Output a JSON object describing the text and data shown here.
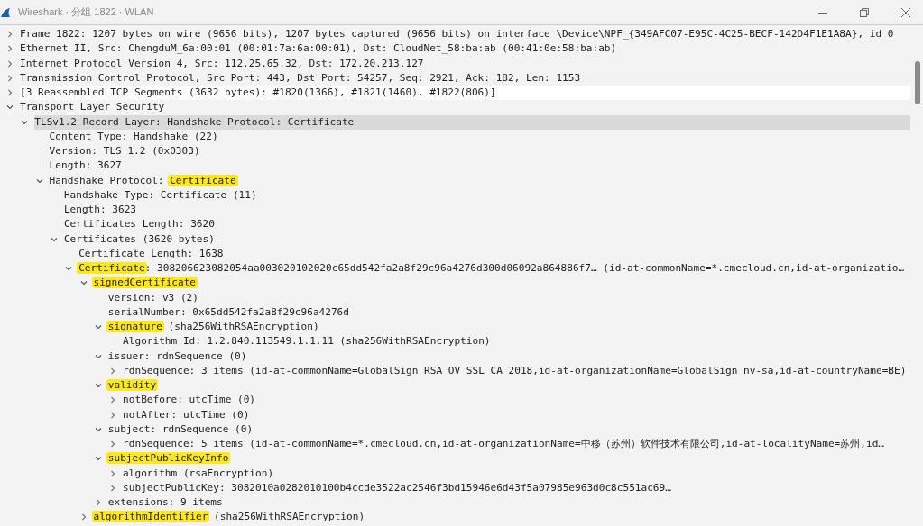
{
  "window": {
    "title": "Wireshark · 分组 1822 · WLAN"
  },
  "tree": [
    {
      "text": "Frame 1822: 1207 bytes on wire (9656 bits), 1207 bytes captured (9656 bits) on interface \\Device\\NPF_{349AFC07-E95C-4C25-BECF-142D4F1E1A8A}, id 0",
      "expanded": false,
      "selected": false,
      "hovered": false
    },
    {
      "text": "Ethernet II, Src: ChengduM_6a:00:01 (00:01:7a:6a:00:01), Dst: CloudNet_58:ba:ab (00:41:0e:58:ba:ab)",
      "expanded": false,
      "selected": false,
      "hovered": false
    },
    {
      "text": "Internet Protocol Version 4, Src: 112.25.65.32, Dst: 172.20.213.127",
      "expanded": false,
      "selected": false,
      "hovered": false
    },
    {
      "text": "Transmission Control Protocol, Src Port: 443, Dst Port: 54257, Seq: 2921, Ack: 182, Len: 1153",
      "expanded": false,
      "selected": false,
      "hovered": false
    },
    {
      "text": "[3 Reassembled TCP Segments (3632 bytes): #1820(1366), #1821(1460), #1822(806)]",
      "expanded": false,
      "selected": false,
      "hovered": true
    },
    {
      "text": "Transport Layer Security",
      "expanded": true,
      "selected": false,
      "hovered": false,
      "children": [
        {
          "text": "TLSv1.2 Record Layer: Handshake Protocol: Certificate",
          "expanded": true,
          "selected": true,
          "hovered": false,
          "children": [
            {
              "text": "Content Type: Handshake (22)",
              "selected": false,
              "hovered": false
            },
            {
              "text": "Version: TLS 1.2 (0x0303)",
              "selected": false,
              "hovered": false
            },
            {
              "text": "Length: 3627",
              "selected": false,
              "hovered": false
            },
            {
              "before": "Handshake Protocol: ",
              "highlight": "Certificate",
              "expanded": true,
              "selected": false,
              "hovered": false,
              "children": [
                {
                  "text": "Handshake Type: Certificate (11)",
                  "selected": false,
                  "hovered": false
                },
                {
                  "text": "Length: 3623",
                  "selected": false,
                  "hovered": false
                },
                {
                  "text": "Certificates Length: 3620",
                  "selected": false,
                  "hovered": false
                },
                {
                  "text": "Certificates (3620 bytes)",
                  "expanded": true,
                  "selected": false,
                  "hovered": false,
                  "children": [
                    {
                      "text": "Certificate Length: 1638",
                      "selected": false,
                      "hovered": false
                    },
                    {
                      "highlight": "Certificate",
                      "after": ": 308206623082054aa003020102020c65dd542fa2a8f29c96a4276d300d06092a864886f7… (id-at-commonName=*.cmecloud.cn,id-at-organizatio…",
                      "expanded": true,
                      "selected": false,
                      "hovered": false,
                      "children": [
                        {
                          "highlight": "signedCertificate",
                          "expanded": true,
                          "selected": false,
                          "hovered": false,
                          "children": [
                            {
                              "text": "version: v3 (2)",
                              "selected": false,
                              "hovered": false
                            },
                            {
                              "text": "serialNumber: 0x65dd542fa2a8f29c96a4276d",
                              "selected": false,
                              "hovered": false
                            },
                            {
                              "highlight": "signature",
                              "after": " (sha256WithRSAEncryption)",
                              "expanded": true,
                              "selected": false,
                              "hovered": false,
                              "children": [
                                {
                                  "text": "Algorithm Id: 1.2.840.113549.1.1.11 (sha256WithRSAEncryption)",
                                  "selected": false,
                                  "hovered": false
                                }
                              ]
                            },
                            {
                              "text": "issuer: rdnSequence (0)",
                              "expanded": true,
                              "selected": false,
                              "hovered": false,
                              "children": [
                                {
                                  "text": "rdnSequence: 3 items (id-at-commonName=GlobalSign RSA OV SSL CA 2018,id-at-organizationName=GlobalSign nv-sa,id-at-countryName=BE)",
                                  "expanded": false,
                                  "selected": false,
                                  "hovered": false
                                }
                              ]
                            },
                            {
                              "highlight": "validity",
                              "expanded": true,
                              "selected": false,
                              "hovered": false,
                              "children": [
                                {
                                  "text": "notBefore: utcTime (0)",
                                  "expanded": false,
                                  "selected": false,
                                  "hovered": false
                                },
                                {
                                  "text": "notAfter: utcTime (0)",
                                  "expanded": false,
                                  "selected": false,
                                  "hovered": false
                                }
                              ]
                            },
                            {
                              "text": "subject: rdnSequence (0)",
                              "expanded": true,
                              "selected": false,
                              "hovered": false,
                              "children": [
                                {
                                  "text": "rdnSequence: 5 items (id-at-commonName=*.cmecloud.cn,id-at-organizationName=中移（苏州）软件技术有限公司,id-at-localityName=苏州,id…",
                                  "expanded": false,
                                  "selected": false,
                                  "hovered": false
                                }
                              ]
                            },
                            {
                              "highlight": "subjectPublicKeyInfo",
                              "expanded": true,
                              "selected": false,
                              "hovered": false,
                              "children": [
                                {
                                  "text": "algorithm (rsaEncryption)",
                                  "expanded": false,
                                  "selected": false,
                                  "hovered": false
                                },
                                {
                                  "text": "subjectPublicKey: 3082010a0282010100b4ccde3522ac2546f3bd15946e6d43f5a07985e963d0c8c551ac69…",
                                  "expanded": false,
                                  "selected": false,
                                  "hovered": false
                                }
                              ]
                            },
                            {
                              "text": "extensions: 9 items",
                              "expanded": false,
                              "selected": false,
                              "hovered": false
                            }
                          ]
                        },
                        {
                          "highlight": "algorithmIdentifier",
                          "after": " (sha256WithRSAEncryption)",
                          "expanded": false,
                          "selected": false,
                          "hovered": false
                        }
                      ]
                    }
                  ]
                }
              ]
            }
          ]
        }
      ]
    }
  ]
}
